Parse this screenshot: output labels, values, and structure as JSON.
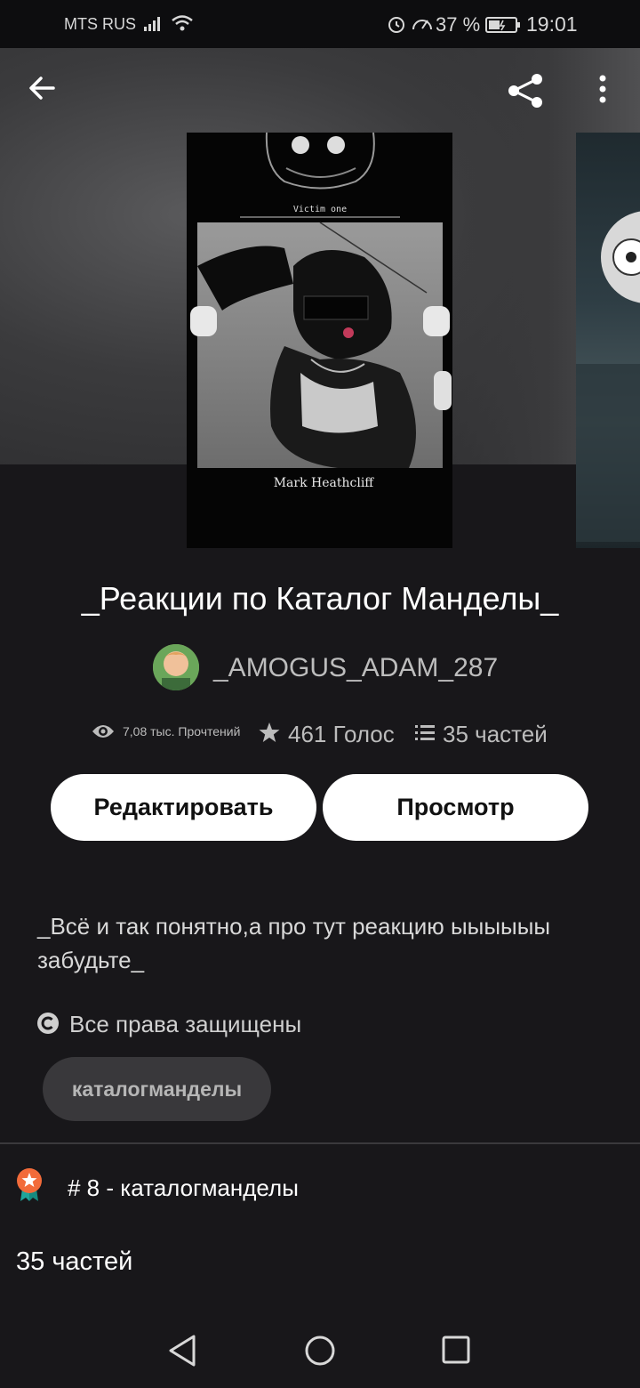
{
  "status_bar": {
    "carrier": "MTS RUS",
    "battery_percent": "37 %",
    "time": "19:01"
  },
  "header": {
    "back_icon": "arrow-left-icon",
    "share_icon": "share-icon",
    "more_icon": "more-vertical-icon"
  },
  "cover": {
    "caption_top": "Victim one",
    "caption_bottom": "Mark Heathcliff"
  },
  "story": {
    "title": "_Реакции по Каталог Манделы_",
    "author": "_AMOGUS_ADAM_287",
    "reads": "7,08 тыс. Прочтений",
    "votes": "461 Голос",
    "parts_count": "35 частей",
    "description": "_Всё и так понятно,а про тут реакцию ыыыыыы забудьте_",
    "copyright": "Все права защищены",
    "tag": "каталогманделы",
    "rank": "# 8 - каталогманделы",
    "parts_heading": "35 частей"
  },
  "actions": {
    "edit_label": "Редактировать",
    "view_label": "Просмотр"
  },
  "colors": {
    "background": "#18171a",
    "button_bg": "#ffffff",
    "tag_bg": "#39383b",
    "rank_badge": "#f26b3a"
  }
}
